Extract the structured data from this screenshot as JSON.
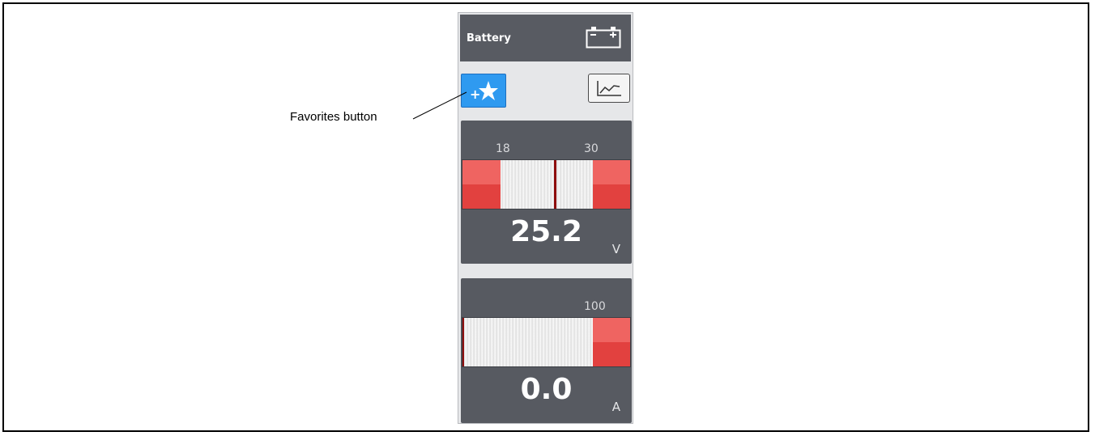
{
  "panel": {
    "title": "Battery",
    "icon": "battery-icon"
  },
  "toolbar": {
    "favorites_icon": "add-favorite-star-icon",
    "graph_icon": "line-graph-icon"
  },
  "voltage_gauge": {
    "low_limit": "18",
    "high_limit": "30",
    "value": "25.2",
    "unit": "V"
  },
  "current_gauge": {
    "high_limit": "100",
    "value": "0.0",
    "unit": "A"
  },
  "callout": {
    "label": "Favorites button"
  },
  "colors": {
    "accent": "#2f9af0",
    "panel_dark": "#575a61",
    "alarm_red": "#e2413f"
  }
}
